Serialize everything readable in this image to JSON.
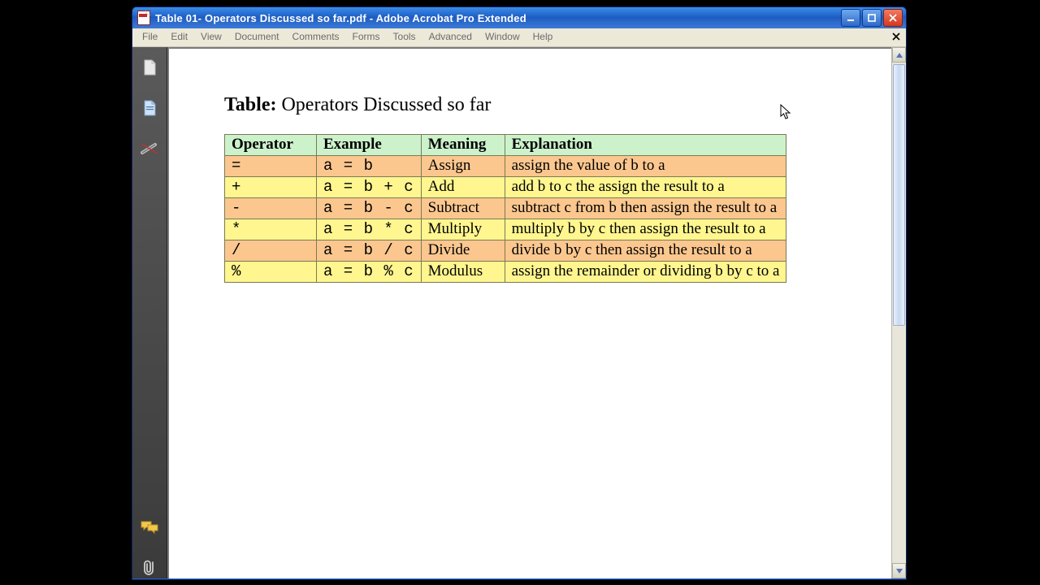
{
  "window": {
    "title": "Table 01- Operators Discussed so far.pdf - Adobe Acrobat Pro Extended"
  },
  "menus": [
    "File",
    "Edit",
    "View",
    "Document",
    "Comments",
    "Forms",
    "Tools",
    "Advanced",
    "Window",
    "Help"
  ],
  "nav_icons": [
    "pages-icon",
    "bookmarks-icon",
    "signatures-icon",
    "comments-icon",
    "attachments-icon"
  ],
  "doc": {
    "heading_bold": "Table:",
    "heading_rest": " Operators Discussed so far",
    "columns": [
      "Operator",
      "Example",
      "Meaning",
      "Explanation"
    ],
    "rows": [
      {
        "op": "=",
        "ex": "a = b",
        "mn": "Assign",
        "expl": "assign the value of b to a"
      },
      {
        "op": "+",
        "ex": "a = b + c",
        "mn": "Add",
        "expl": "add b to c the assign the result to a"
      },
      {
        "op": "-",
        "ex": "a = b - c",
        "mn": "Subtract",
        "expl": "subtract c from b then assign the result to a"
      },
      {
        "op": "*",
        "ex": "a = b * c",
        "mn": "Multiply",
        "expl": "multiply b by c then assign the result to a"
      },
      {
        "op": "/",
        "ex": "a = b / c",
        "mn": "Divide",
        "expl": "divide b by c then assign the result to a"
      },
      {
        "op": "%",
        "ex": "a = b % c",
        "mn": "Modulus",
        "expl": "assign the remainder or dividing b by c to a"
      }
    ]
  }
}
